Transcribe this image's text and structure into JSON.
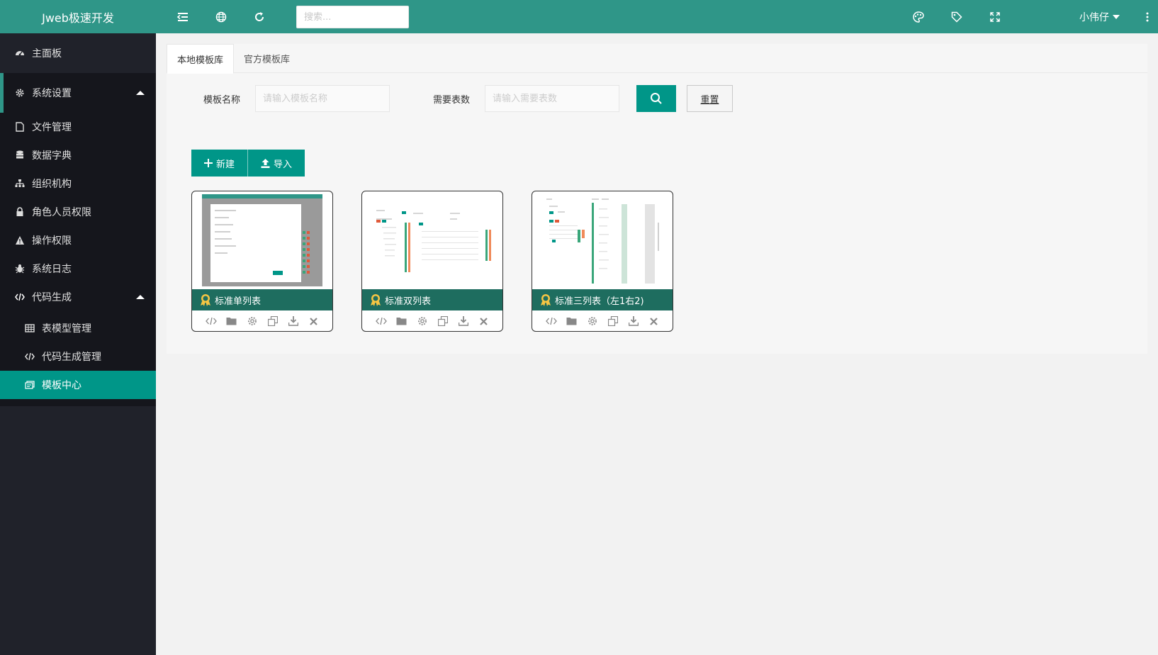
{
  "app": {
    "logo": "Jweb极速开发"
  },
  "header": {
    "search_placeholder": "搜索...",
    "user_name": "小伟仔"
  },
  "sidebar": {
    "items": [
      {
        "label": "主面板",
        "icon": "dashboard-icon"
      },
      {
        "label": "系统设置",
        "icon": "gear-icon"
      },
      {
        "label": "文件管理",
        "icon": "file-icon"
      },
      {
        "label": "数据字典",
        "icon": "database-icon"
      },
      {
        "label": "组织机构",
        "icon": "sitemap-icon"
      },
      {
        "label": "角色人员权限",
        "icon": "lock-icon"
      },
      {
        "label": "操作权限",
        "icon": "warning-icon"
      },
      {
        "label": "系统日志",
        "icon": "bug-icon"
      },
      {
        "label": "代码生成",
        "icon": "code-icon"
      },
      {
        "label": "表模型管理",
        "icon": "table-icon"
      },
      {
        "label": "代码生成管理",
        "icon": "code-icon"
      },
      {
        "label": "模板中心",
        "icon": "template-icon"
      }
    ]
  },
  "tabs": [
    {
      "label": "本地模板库"
    },
    {
      "label": "官方模板库"
    }
  ],
  "filter": {
    "name_label": "模板名称",
    "name_placeholder": "请输入模板名称",
    "tables_label": "需要表数",
    "tables_placeholder": "请输入需要表数",
    "reset_label": "重置"
  },
  "actions": {
    "new_label": "新建",
    "import_label": "导入"
  },
  "cards": [
    {
      "title": "标准单列表"
    },
    {
      "title": "标准双列表"
    },
    {
      "title": "标准三列表（左1右2)"
    }
  ],
  "colors": {
    "header": "#2f9688",
    "primary": "#009688",
    "sidebar": "#20222a",
    "card_title": "#1e6d5f",
    "badge": "#f6c543"
  }
}
